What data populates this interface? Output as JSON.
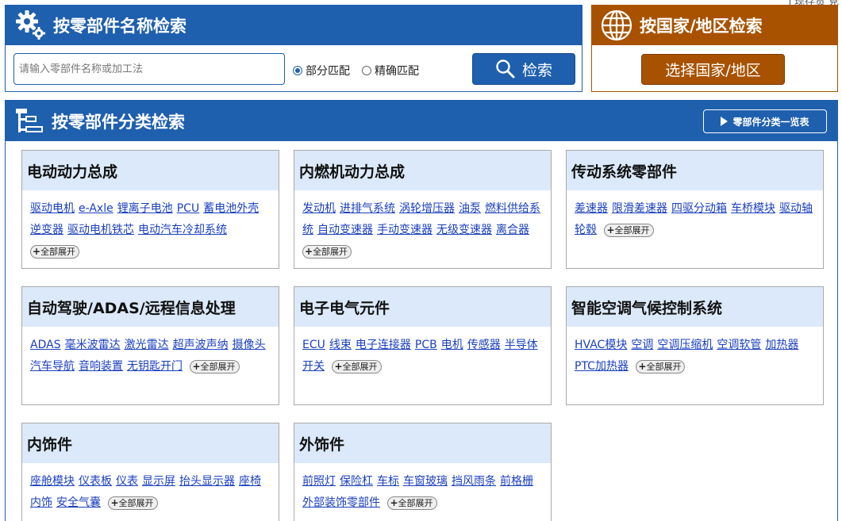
{
  "top_snippet": "↑现存货  見",
  "name_search": {
    "title": "按零部件名称检索",
    "placeholder": "请输入零部件名称或加工法",
    "radio_partial": "部分匹配",
    "radio_exact": "精确匹配",
    "search_label": "检索"
  },
  "country_search": {
    "title": "按国家/地区检索",
    "button_label": "选择国家/地区"
  },
  "category_search": {
    "title": "按零部件分类检索",
    "list_button": "零部件分类一览表",
    "expand_label": "全部展开",
    "categories": [
      {
        "title": "电动动力总成",
        "links": [
          "驱动电机",
          "e-Axle",
          "锂离子电池",
          "PCU",
          "蓄电池外壳",
          "逆变器",
          "驱动电机铁芯",
          "电动汽车冷却系统"
        ]
      },
      {
        "title": "内燃机动力总成",
        "links": [
          "发动机",
          "进排气系统",
          "涡轮增压器",
          "油泵",
          "燃料供给系统",
          "自动变速器",
          "手动变速器",
          "无级变速器",
          "离合器"
        ]
      },
      {
        "title": "传动系统零部件",
        "links": [
          "差速器",
          "限滑差速器",
          "四驱分动箱",
          "车桥模块",
          "驱动轴",
          "轮毂"
        ]
      },
      {
        "title": "自动驾驶/ADAS/远程信息处理",
        "links": [
          "ADAS",
          "毫米波雷达",
          "激光雷达",
          "超声波声纳",
          "摄像头",
          "汽车导航",
          "音响装置",
          "无钥匙开门"
        ]
      },
      {
        "title": "电子电气元件",
        "links": [
          "ECU",
          "线束",
          "电子连接器",
          "PCB",
          "电机",
          "传感器",
          "半导体",
          "开关"
        ]
      },
      {
        "title": "智能空调气候控制系统",
        "links": [
          "HVAC模块",
          "空调",
          "空调压缩机",
          "空调软管",
          "加热器",
          "PTC加热器"
        ]
      },
      {
        "title": "内饰件",
        "links": [
          "座舱模块",
          "仪表板",
          "仪表",
          "显示屏",
          "抬头显示器",
          "座椅",
          "内饰",
          "安全气囊"
        ]
      },
      {
        "title": "外饰件",
        "links": [
          "前照灯",
          "保险杠",
          "车标",
          "车窗玻璃",
          "挡风雨条",
          "前格栅",
          "外部装饰零部件"
        ]
      }
    ]
  }
}
